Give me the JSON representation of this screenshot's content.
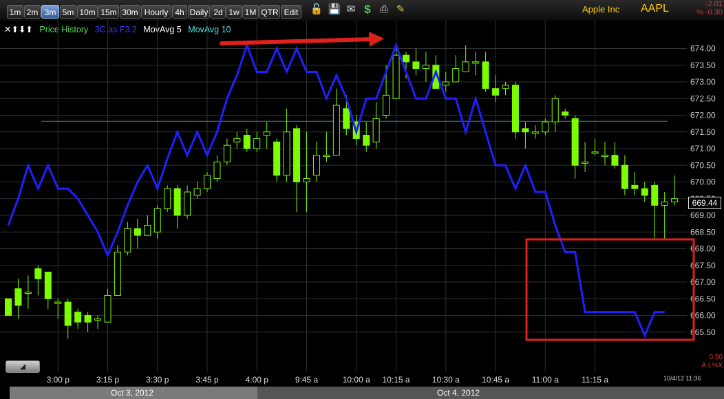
{
  "toolbar": {
    "timeframes": [
      "1m",
      "2m",
      "3m",
      "5m",
      "10m",
      "15m",
      "30m",
      "Hourly",
      "4h",
      "Daily",
      "2d",
      "1w",
      "1M",
      "QTR",
      "Edit"
    ],
    "active": "3m",
    "icons": [
      "lock-icon",
      "save-icon",
      "mail-icon",
      "dollar-icon",
      "print-icon",
      "pencil-icon"
    ]
  },
  "header": {
    "company": "Apple Inc",
    "ticker": "AAPL",
    "change": "-2.01",
    "change_pct": "% -0.30"
  },
  "legend": {
    "icons": "✕⬆⬇⬆",
    "price_history": "Price History",
    "three_c": "3C as F3.2",
    "mavg5": "MovAvg 5",
    "mavg10": "MovAvg 10"
  },
  "colors": {
    "up": "#7cfc00",
    "down": "#7cfc00",
    "three_c": "#1f1fff",
    "arrow": "#e0201a",
    "box": "#e0201a",
    "price_line": "#4a7fa0",
    "legend_green": "#55dd55",
    "legend_blue": "#3a3aff",
    "legend_cyan": "#55e0e0"
  },
  "chart_data": {
    "type": "line",
    "title": "",
    "y_ticks": [
      "674.00",
      "673.50",
      "673.00",
      "672.50",
      "672.00",
      "671.50",
      "671.00",
      "670.50",
      "670.00",
      "669.50",
      "669.00",
      "668.50",
      "668.00",
      "667.50",
      "667.00",
      "666.50",
      "666.00",
      "665.50"
    ],
    "ylim": [
      665.1,
      674.6
    ],
    "x_ticks": [
      "3:00 p",
      "3:15 p",
      "3:30 p",
      "3:45 p",
      "4:00 p",
      "9:45 a",
      "10:00 a",
      "10:15 a",
      "10:30 a",
      "10:45 a",
      "11:00 a",
      "11:15 a"
    ],
    "x_tick_index": [
      5,
      10,
      15,
      20,
      25,
      30,
      35,
      39,
      44,
      49,
      54,
      59
    ],
    "dates": [
      "Oct 3, 2012",
      "Oct 4, 2012"
    ],
    "last_price": "669.44",
    "reference_price": 671.82,
    "candles": [
      [
        666.5,
        666.0,
        666.5,
        666.5
      ],
      [
        666.8,
        666.3,
        667.1,
        665.9
      ],
      [
        666.7,
        666.7,
        667.2,
        666.2
      ],
      [
        667.4,
        667.1,
        667.5,
        666.6
      ],
      [
        667.3,
        666.5,
        667.3,
        666.2
      ],
      [
        666.4,
        666.4,
        666.5,
        665.9
      ],
      [
        666.4,
        665.7,
        666.5,
        665.3
      ],
      [
        666.1,
        665.8,
        666.2,
        665.6
      ],
      [
        666.0,
        665.8,
        666.1,
        665.5
      ],
      [
        665.9,
        665.9,
        666.0,
        665.6
      ],
      [
        665.8,
        666.6,
        666.8,
        665.8
      ],
      [
        666.6,
        667.9,
        668.1,
        666.6
      ],
      [
        667.9,
        668.6,
        668.8,
        667.8
      ],
      [
        668.6,
        668.4,
        668.9,
        668.0
      ],
      [
        668.4,
        668.7,
        669.0,
        668.4
      ],
      [
        668.5,
        669.2,
        669.3,
        668.3
      ],
      [
        669.2,
        669.8,
        669.9,
        669.1
      ],
      [
        669.8,
        669.0,
        669.9,
        668.6
      ],
      [
        669.0,
        669.7,
        669.9,
        668.9
      ],
      [
        669.6,
        669.8,
        670.0,
        669.5
      ],
      [
        669.8,
        670.2,
        670.3,
        669.7
      ],
      [
        670.1,
        670.6,
        670.8,
        670.0
      ],
      [
        670.6,
        671.1,
        671.3,
        670.5
      ],
      [
        671.2,
        671.3,
        671.5,
        671.0
      ],
      [
        671.4,
        671.0,
        671.6,
        670.9
      ],
      [
        671.0,
        671.3,
        671.5,
        670.9
      ],
      [
        671.4,
        671.5,
        671.8,
        671.0
      ],
      [
        671.2,
        670.2,
        671.3,
        670.0
      ],
      [
        670.2,
        671.5,
        672.2,
        670.0
      ],
      [
        671.6,
        670.0,
        671.7,
        669.1
      ],
      [
        670.0,
        670.1,
        671.5,
        669.1
      ],
      [
        670.2,
        670.8,
        671.2,
        670.0
      ],
      [
        670.8,
        670.8,
        671.5,
        670.6
      ],
      [
        670.8,
        672.3,
        672.8,
        670.8
      ],
      [
        672.2,
        671.6,
        672.6,
        671.4
      ],
      [
        671.8,
        671.3,
        672.0,
        671.1
      ],
      [
        671.4,
        671.1,
        671.8,
        670.9
      ],
      [
        671.2,
        671.9,
        672.4,
        671.0
      ],
      [
        672.0,
        672.6,
        673.5,
        671.9
      ],
      [
        672.5,
        673.8,
        674.1,
        672.6
      ],
      [
        673.8,
        673.6,
        673.9,
        673.1
      ],
      [
        673.6,
        673.4,
        674.0,
        673.2
      ],
      [
        673.4,
        673.5,
        673.9,
        673.0
      ],
      [
        673.5,
        672.8,
        673.8,
        672.8
      ],
      [
        672.9,
        673.0,
        673.3,
        672.7
      ],
      [
        673.0,
        673.4,
        673.8,
        673.0
      ],
      [
        673.3,
        673.6,
        674.1,
        673.3
      ],
      [
        673.6,
        673.6,
        673.9,
        673.2
      ],
      [
        673.6,
        672.8,
        673.9,
        672.7
      ],
      [
        672.8,
        672.6,
        673.2,
        672.4
      ],
      [
        672.8,
        672.9,
        673.0,
        672.6
      ],
      [
        672.9,
        671.5,
        673.0,
        671.3
      ],
      [
        671.6,
        671.5,
        671.8,
        671.0
      ],
      [
        671.5,
        671.5,
        671.7,
        671.3
      ],
      [
        671.5,
        671.8,
        671.9,
        671.4
      ],
      [
        671.8,
        672.5,
        672.6,
        671.5
      ],
      [
        672.1,
        672.0,
        672.2,
        671.9
      ],
      [
        671.9,
        670.5,
        672.0,
        670.1
      ],
      [
        670.6,
        670.6,
        671.2,
        670.3
      ],
      [
        670.9,
        670.9,
        671.3,
        670.8
      ],
      [
        670.8,
        670.8,
        671.2,
        670.5
      ],
      [
        670.8,
        670.5,
        671.2,
        670.4
      ],
      [
        670.5,
        669.8,
        670.8,
        669.6
      ],
      [
        669.9,
        669.8,
        670.3,
        669.6
      ],
      [
        669.8,
        669.6,
        670.0,
        669.4
      ],
      [
        669.9,
        669.3,
        670.0,
        668.3
      ],
      [
        669.3,
        669.4,
        669.7,
        668.3
      ],
      [
        669.4,
        669.5,
        670.2,
        669.3
      ]
    ],
    "series": [
      {
        "name": "3C as F3.2",
        "values": [
          668.7,
          669.5,
          670.5,
          669.8,
          670.5,
          669.8,
          669.8,
          669.5,
          669.0,
          668.5,
          667.8,
          668.5,
          669.3,
          670.0,
          670.5,
          669.8,
          670.7,
          671.5,
          670.8,
          671.5,
          670.8,
          671.5,
          672.5,
          673.2,
          674.1,
          673.3,
          673.3,
          674.0,
          673.3,
          674.0,
          673.3,
          673.3,
          672.5,
          673.2,
          672.5,
          671.5,
          672.5,
          672.5,
          673.3,
          674.1,
          673.3,
          672.5,
          672.5,
          673.3,
          672.5,
          672.5,
          671.5,
          672.5,
          671.5,
          670.5,
          670.5,
          669.8,
          670.5,
          669.7,
          669.7,
          668.7,
          667.9,
          667.9,
          666.1,
          666.1,
          666.1,
          666.1,
          666.1,
          666.1,
          665.4,
          666.1,
          666.1
        ]
      }
    ]
  },
  "annotations": {
    "timestamp": "10/4/12 11:36",
    "bottom_right": [
      "0.50",
      "A",
      ".L",
      "%",
      "X"
    ]
  }
}
